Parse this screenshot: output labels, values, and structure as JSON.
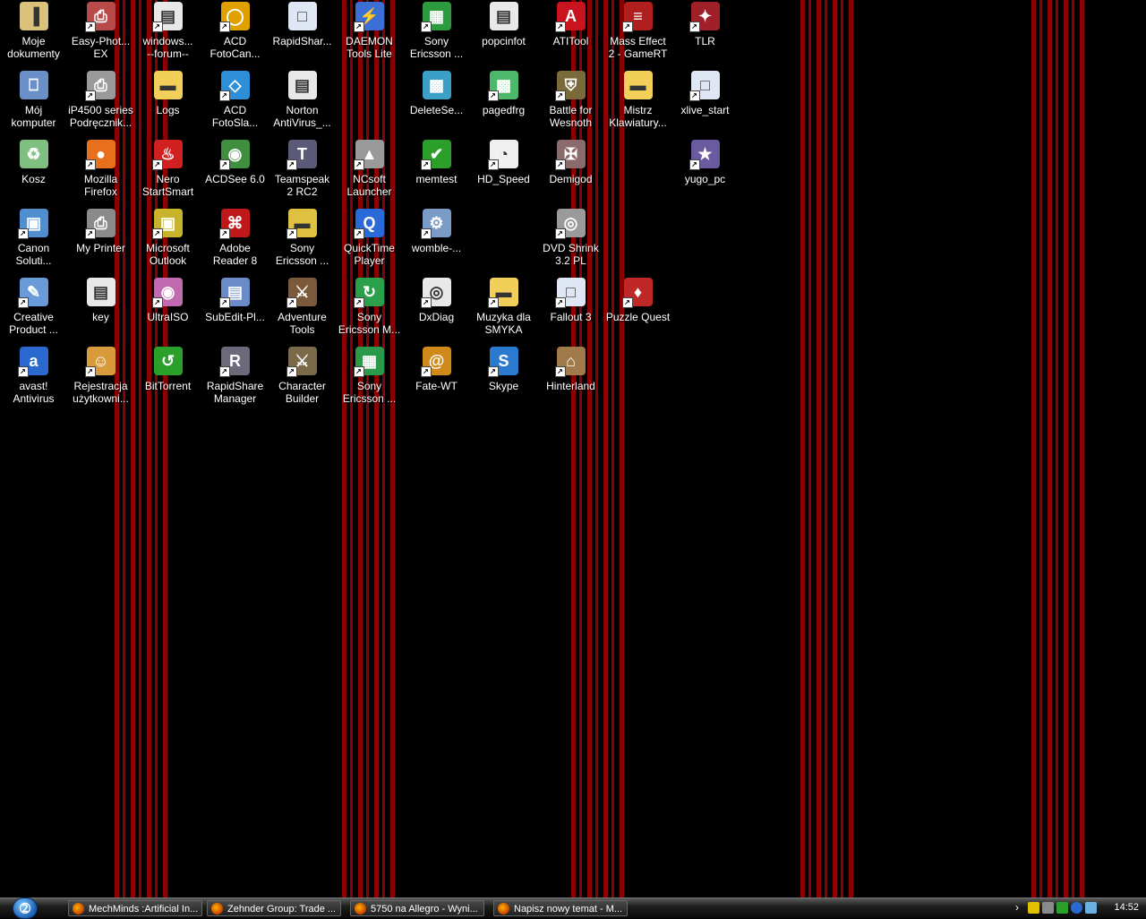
{
  "colors": {
    "wallpaper_bg": "#000000",
    "stripe": "#8b0000"
  },
  "desktop": {
    "icons": [
      {
        "name": "moje-dokumenty",
        "label": "Moje\ndokumenty",
        "icon": "folder-documents-icon",
        "color": "#d9c27a",
        "glyph": "▐",
        "shortcut": false
      },
      {
        "name": "easy-photo",
        "label": "Easy-Phot...\nEX",
        "icon": "printer-icon",
        "color": "#b94a4a",
        "glyph": "⎙",
        "shortcut": true
      },
      {
        "name": "windows-forum",
        "label": "windows...\n--forum--",
        "icon": "document-icon",
        "color": "#e8e8e8",
        "glyph": "▤",
        "shortcut": true
      },
      {
        "name": "acd-fotocanvas",
        "label": "ACD\nFotoCan...",
        "icon": "ring-icon",
        "color": "#e0a000",
        "glyph": "◯",
        "shortcut": true
      },
      {
        "name": "rapidshare",
        "label": "RapidShar...",
        "icon": "window-icon",
        "color": "#dfe7f4",
        "glyph": "□",
        "shortcut": false
      },
      {
        "name": "daemon-tools",
        "label": "DAEMON\nTools Lite",
        "icon": "lightning-icon",
        "color": "#3b6fd6",
        "glyph": "⚡",
        "shortcut": true
      },
      {
        "name": "sony-ericsson-1",
        "label": "Sony\nEricsson ...",
        "icon": "phone-app-icon",
        "color": "#2e9a3e",
        "glyph": "▦",
        "shortcut": true
      },
      {
        "name": "popcinfot",
        "label": "popcinfot",
        "icon": "document-icon",
        "color": "#e8e8e8",
        "glyph": "▤",
        "shortcut": false
      },
      {
        "name": "atitool",
        "label": "ATITool",
        "icon": "ati-icon",
        "color": "#c8141e",
        "glyph": "A",
        "shortcut": true
      },
      {
        "name": "mass-effect",
        "label": "Mass Effect\n2 - GameRT",
        "icon": "game-icon",
        "color": "#b01e1e",
        "glyph": "≡",
        "shortcut": true
      },
      {
        "name": "tlr",
        "label": "TLR",
        "icon": "game-icon",
        "color": "#a0202a",
        "glyph": "✦",
        "shortcut": true
      },
      {
        "name": "moj-komputer",
        "label": "Mój\nkomputer",
        "icon": "computer-icon",
        "color": "#6b8fc9",
        "glyph": "⎕",
        "shortcut": false
      },
      {
        "name": "ip4500-series",
        "label": "iP4500 series\nPodręcznik...",
        "icon": "printer-icon",
        "color": "#9a9a9a",
        "glyph": "⎙",
        "shortcut": true
      },
      {
        "name": "logs",
        "label": "Logs",
        "icon": "folder-icon",
        "color": "#f2cf58",
        "glyph": "▬",
        "shortcut": false
      },
      {
        "name": "acd-fotoslate",
        "label": "ACD\nFotoSla...",
        "icon": "fotoslate-icon",
        "color": "#2c8fd8",
        "glyph": "◇",
        "shortcut": true
      },
      {
        "name": "norton-antivirus",
        "label": "Norton\nAntiVirus_...",
        "icon": "document-icon",
        "color": "#e8e8e8",
        "glyph": "▤",
        "shortcut": false
      },
      {
        "name": "deleteservice",
        "label": "DeleteSe...",
        "icon": "cube-icon",
        "color": "#3aa0c8",
        "glyph": "▩",
        "shortcut": false
      },
      {
        "name": "pagedfrg",
        "label": "pagedfrg",
        "icon": "cube-icon",
        "color": "#4db86a",
        "glyph": "▩",
        "shortcut": true
      },
      {
        "name": "battle-for-wesnoth",
        "label": "Battle for\nWesnoth",
        "icon": "shield-icon",
        "color": "#7a6a3a",
        "glyph": "⛨",
        "shortcut": true
      },
      {
        "name": "mistrz-klawiatury",
        "label": "Mistrz\nKlawiatury...",
        "icon": "folder-icon",
        "color": "#f2cf58",
        "glyph": "▬",
        "shortcut": false
      },
      {
        "name": "xlive-start",
        "label": "xlive_start",
        "icon": "window-icon",
        "color": "#dfe7f4",
        "glyph": "□",
        "shortcut": true
      },
      {
        "name": "kosz",
        "label": "Kosz",
        "icon": "recycle-bin-icon",
        "color": "#7fbf7f",
        "glyph": "♻",
        "shortcut": false
      },
      {
        "name": "mozilla-firefox",
        "label": "Mozilla\nFirefox",
        "icon": "firefox-icon",
        "color": "#e8701c",
        "glyph": "●",
        "shortcut": true
      },
      {
        "name": "nero-startsmart",
        "label": "Nero\nStartSmart",
        "icon": "flame-icon",
        "color": "#d02020",
        "glyph": "♨",
        "shortcut": true
      },
      {
        "name": "acdsee",
        "label": "ACDSee 6.0",
        "icon": "eye-icon",
        "color": "#3f8f3f",
        "glyph": "◉",
        "shortcut": true
      },
      {
        "name": "teamspeak",
        "label": "Teamspeak\n2 RC2",
        "icon": "teamspeak-icon",
        "color": "#5a5a78",
        "glyph": "T",
        "shortcut": true
      },
      {
        "name": "ncsoft-launcher",
        "label": "NCsoft\nLauncher",
        "icon": "launcher-icon",
        "color": "#9a9a9a",
        "glyph": "▲",
        "shortcut": true
      },
      {
        "name": "memtest",
        "label": "memtest",
        "icon": "checkmark-chip-icon",
        "color": "#2aa02a",
        "glyph": "✔",
        "shortcut": true
      },
      {
        "name": "hd-speed",
        "label": "HD_Speed",
        "icon": "gauge-icon",
        "color": "#f0f0f0",
        "glyph": "◔",
        "shortcut": true
      },
      {
        "name": "demigod",
        "label": "Demigod",
        "icon": "game-icon",
        "color": "#8a6a6a",
        "glyph": "✠",
        "shortcut": true
      },
      {
        "name": "yugo-pc",
        "label": "yugo_pc",
        "icon": "game-icon",
        "color": "#6a5aa0",
        "glyph": "★",
        "shortcut": true
      },
      {
        "name": "canon-solution",
        "label": "Canon\nSoluti...",
        "icon": "canon-icon",
        "color": "#4f8fcf",
        "glyph": "▣",
        "shortcut": true
      },
      {
        "name": "my-printer",
        "label": "My Printer",
        "icon": "printer-user-icon",
        "color": "#8a8a8a",
        "glyph": "⎙",
        "shortcut": true
      },
      {
        "name": "microsoft-outlook",
        "label": "Microsoft\nOutlook",
        "icon": "outlook-icon",
        "color": "#c8b42a",
        "glyph": "▣",
        "shortcut": true
      },
      {
        "name": "adobe-reader",
        "label": "Adobe\nReader 8",
        "icon": "pdf-icon",
        "color": "#c01818",
        "glyph": "⌘",
        "shortcut": true
      },
      {
        "name": "sony-ericsson-2",
        "label": "Sony\nEricsson ...",
        "icon": "phone-folder-icon",
        "color": "#e0c040",
        "glyph": "▬",
        "shortcut": true
      },
      {
        "name": "quicktime-player",
        "label": "QuickTime\nPlayer",
        "icon": "quicktime-icon",
        "color": "#2a6ad8",
        "glyph": "Q",
        "shortcut": true
      },
      {
        "name": "womble",
        "label": "womble-...",
        "icon": "installer-icon",
        "color": "#7a9ac8",
        "glyph": "⚙",
        "shortcut": true
      },
      {
        "name": "dvd-shrink",
        "label": "DVD Shrink\n3.2 PL",
        "icon": "dvd-icon",
        "color": "#9a9a9a",
        "glyph": "◎",
        "shortcut": true
      },
      {
        "name": "creative-product",
        "label": "Creative\nProduct ...",
        "icon": "pencil-icon",
        "color": "#6a9ad8",
        "glyph": "✎",
        "shortcut": true
      },
      {
        "name": "key",
        "label": "key",
        "icon": "document-icon",
        "color": "#e8e8e8",
        "glyph": "▤",
        "shortcut": false
      },
      {
        "name": "ultraiso",
        "label": "UltraISO",
        "icon": "disc-icon",
        "color": "#c06ab0",
        "glyph": "◉",
        "shortcut": true
      },
      {
        "name": "subedit",
        "label": "SubEdit-Pl...",
        "icon": "film-icon",
        "color": "#6a8ac8",
        "glyph": "▤",
        "shortcut": true
      },
      {
        "name": "adventure-tools",
        "label": "Adventure\nTools",
        "icon": "dnd-icon",
        "color": "#7a5a3a",
        "glyph": "⚔",
        "shortcut": true
      },
      {
        "name": "sony-ericsson-m",
        "label": "Sony\nEricsson M...",
        "icon": "sync-icon",
        "color": "#2aa04a",
        "glyph": "↻",
        "shortcut": true
      },
      {
        "name": "dxdiag",
        "label": "DxDiag",
        "icon": "diagnostic-icon",
        "color": "#e8e8e8",
        "glyph": "◎",
        "shortcut": true
      },
      {
        "name": "muzyka-dla-smyka",
        "label": "Muzyka dla\nSMYKA",
        "icon": "folder-icon",
        "color": "#f2cf58",
        "glyph": "▬",
        "shortcut": true
      },
      {
        "name": "fallout-3",
        "label": "Fallout 3",
        "icon": "window-icon",
        "color": "#dfe7f4",
        "glyph": "□",
        "shortcut": true
      },
      {
        "name": "puzzle-quest",
        "label": "Puzzle Quest",
        "icon": "gems-icon",
        "color": "#c02828",
        "glyph": "♦",
        "shortcut": true
      },
      {
        "name": "avast-antivirus",
        "label": "avast!\nAntivirus",
        "icon": "avast-icon",
        "color": "#2a6ad0",
        "glyph": "a",
        "shortcut": true
      },
      {
        "name": "rejestracja",
        "label": "Rejestracja\nużytkowni...",
        "icon": "user-register-icon",
        "color": "#d89a3a",
        "glyph": "☺",
        "shortcut": true
      },
      {
        "name": "bittorrent",
        "label": "BitTorrent",
        "icon": "bittorrent-icon",
        "color": "#2aa02a",
        "glyph": "↺",
        "shortcut": false
      },
      {
        "name": "rapidshare-manager",
        "label": "RapidShare\nManager",
        "icon": "rs-icon",
        "color": "#6a6a7a",
        "glyph": "R",
        "shortcut": true
      },
      {
        "name": "character-builder",
        "label": "Character\nBuilder",
        "icon": "dnd-icon",
        "color": "#7a6a4a",
        "glyph": "⚔",
        "shortcut": true
      },
      {
        "name": "sony-ericsson-3",
        "label": "Sony\nEricsson ...",
        "icon": "phone-app-icon",
        "color": "#2a9a4a",
        "glyph": "▦",
        "shortcut": true
      },
      {
        "name": "fate-wt",
        "label": "Fate-WT",
        "icon": "swirl-icon",
        "color": "#d08a1a",
        "glyph": "@",
        "shortcut": true
      },
      {
        "name": "skype",
        "label": "Skype",
        "icon": "skype-icon",
        "color": "#2a7ad0",
        "glyph": "S",
        "shortcut": true
      },
      {
        "name": "hinterland",
        "label": "Hinterland",
        "icon": "house-icon",
        "color": "#a07a4a",
        "glyph": "⌂",
        "shortcut": true
      }
    ]
  },
  "taskbar": {
    "start_label": "",
    "tasks": [
      {
        "label": "MechMinds :Artificial In..."
      },
      {
        "label": "Zehnder Group: Trade ..."
      },
      {
        "label": "5750 na Allegro - Wyni..."
      },
      {
        "label": "Napisz nowy temat - M..."
      }
    ],
    "tray_icons": [
      "chevron-icon",
      "norton-tray-icon",
      "network-tray-icon",
      "check-tray-icon",
      "avast-tray-icon",
      "messenger-tray-icon"
    ],
    "clock": "14:52"
  }
}
